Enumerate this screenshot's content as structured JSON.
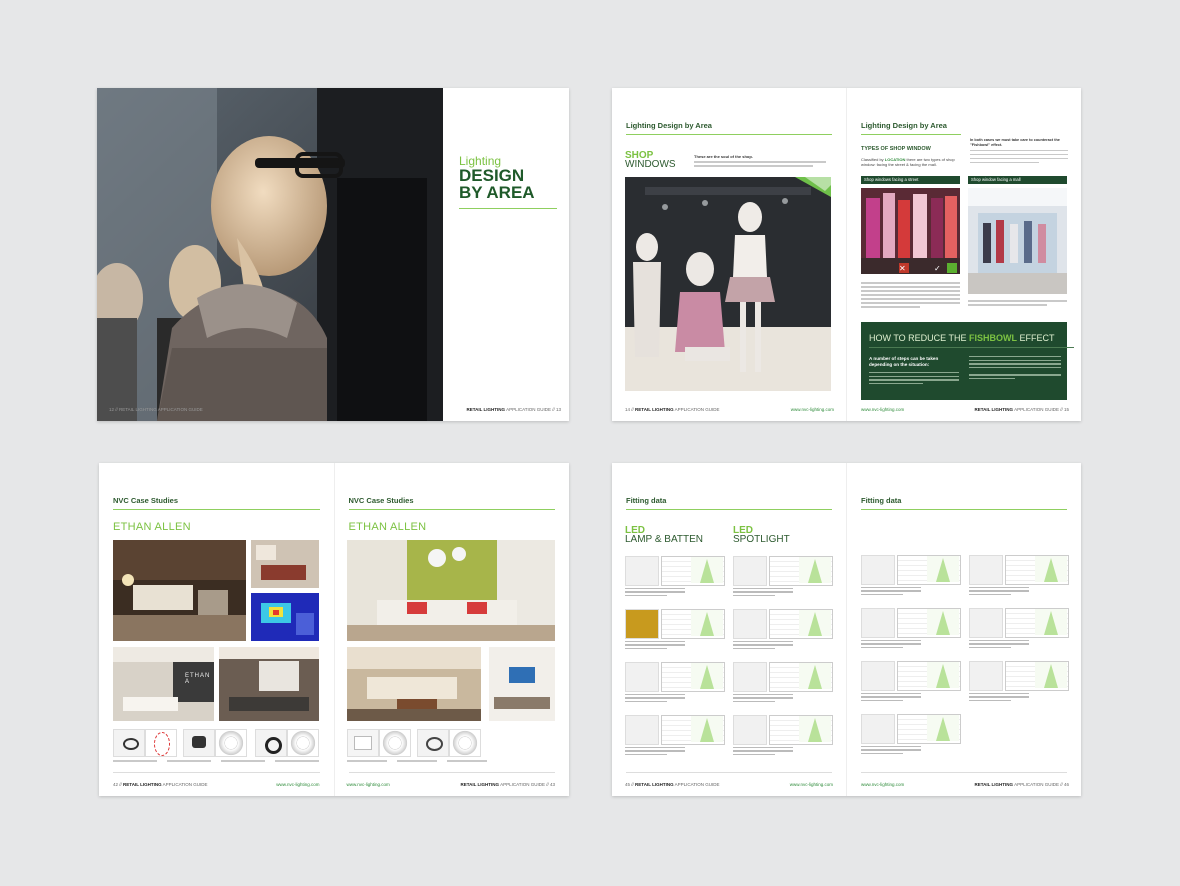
{
  "colors": {
    "green": "#2e8b3a",
    "light_green": "#7cc242",
    "dark_green": "#1f4a2e",
    "background": "#e6e7e8"
  },
  "spread1": {
    "title_small": "Lighting",
    "title_big_line1": "DESIGN",
    "title_big_line2": "BY AREA",
    "footer_left": "12 // RETAIL LIGHTING APPLICATION GUIDE",
    "footer_right_bold": "RETAIL LIGHTING",
    "footer_right_rest": " APPLICATION GUIDE // 13"
  },
  "spread2": {
    "left": {
      "section": "Lighting Design by Area",
      "shop": "SHOP",
      "windows": "WINDOWS",
      "intro_bold": "These are the soul of the shop.",
      "footer_bold": "RETAIL LIGHTING",
      "footer_page": "14 //",
      "footer_rest": " APPLICATION GUIDE",
      "url": "www.nvc-lighting.com"
    },
    "right": {
      "section": "Lighting Design by Area",
      "types_title": "TYPES OF SHOP WINDOW",
      "types_desc_pre": "Classified by ",
      "types_desc_key": "LOCATION",
      "types_desc_post": " there are two types of shop window: facing the street & facing the mall.",
      "fishbowl_note": "In both cases we must take care to counteract the \"Fishbowl\" effect.",
      "label_street": "Shop windows facing a street",
      "label_mall": "Shop window facing a mall",
      "fishbowl_title_pre": "HOW TO REDUCE THE ",
      "fishbowl_title_key": "FISHBOWL",
      "fishbowl_title_post": " EFFECT",
      "fishbowl_sub": "A number of steps can be taken depending on the situation:",
      "footer_bold": "RETAIL LIGHTING",
      "footer_rest": " APPLICATION GUIDE // 15",
      "url": "www.nvc-lighting.com"
    }
  },
  "spread3": {
    "left": {
      "section": "NVC Case Studies",
      "case": "ETHAN ALLEN",
      "photo_sign": "ETHAN A",
      "footer_page": "42 //",
      "footer_bold": "RETAIL LIGHTING",
      "footer_rest": " APPLICATION GUIDE",
      "url": "www.nvc-lighting.com"
    },
    "right": {
      "section": "NVC Case Studies",
      "case": "ETHAN ALLEN",
      "url": "www.nvc-lighting.com",
      "footer_bold": "RETAIL LIGHTING",
      "footer_rest": " APPLICATION GUIDE // 43"
    }
  },
  "spread4": {
    "left": {
      "section": "Fitting data",
      "cat1_green": "LED",
      "cat1_dark": "LAMP & BATTEN",
      "cat2_green": "LED",
      "cat2_dark": "SPOTLIGHT",
      "footer_page": "45 //",
      "footer_bold": "RETAIL LIGHTING",
      "footer_rest": " APPLICATION GUIDE",
      "url": "www.nvc-lighting.com"
    },
    "right": {
      "section": "Fitting data",
      "url": "www.nvc-lighting.com",
      "footer_bold": "RETAIL LIGHTING",
      "footer_rest": " APPLICATION GUIDE // 46"
    }
  }
}
